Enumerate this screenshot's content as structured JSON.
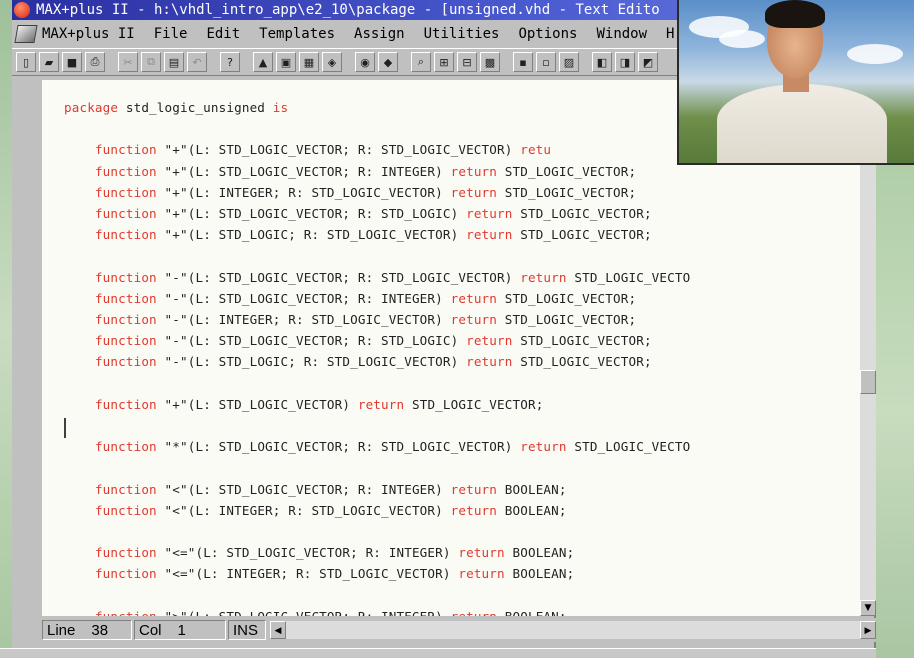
{
  "window": {
    "title": "MAX+plus II - h:\\vhdl_intro_app\\e2_10\\package - [unsigned.vhd - Text Edito"
  },
  "menu": {
    "items": [
      "MAX+plus II",
      "File",
      "Edit",
      "Templates",
      "Assign",
      "Utilities",
      "Options",
      "Window",
      "H"
    ]
  },
  "toolbar": {
    "buttons": [
      {
        "name": "new-file-icon",
        "glyph": "▯",
        "enabled": true
      },
      {
        "name": "open-folder-icon",
        "glyph": "▰",
        "enabled": true
      },
      {
        "name": "save-icon",
        "glyph": "■",
        "enabled": true
      },
      {
        "name": "print-icon",
        "glyph": "⎙",
        "enabled": true
      },
      {
        "name": "cut-icon",
        "glyph": "✂",
        "enabled": false
      },
      {
        "name": "copy-icon",
        "glyph": "⧉",
        "enabled": false
      },
      {
        "name": "paste-icon",
        "glyph": "▤",
        "enabled": true
      },
      {
        "name": "undo-icon",
        "glyph": "↶",
        "enabled": false
      },
      {
        "name": "help-icon",
        "glyph": "?",
        "enabled": true
      },
      {
        "name": "hierarchy-up-icon",
        "glyph": "▲",
        "enabled": true
      },
      {
        "name": "hierarchy-icon",
        "glyph": "▣",
        "enabled": true
      },
      {
        "name": "floorplan-icon",
        "glyph": "▦",
        "enabled": true
      },
      {
        "name": "symbol-icon",
        "glyph": "◈",
        "enabled": true
      },
      {
        "name": "graphic-editor-icon",
        "glyph": "◉",
        "enabled": true
      },
      {
        "name": "waveform-icon",
        "glyph": "◆",
        "enabled": true
      },
      {
        "name": "search-icon",
        "glyph": "⌕",
        "enabled": true
      },
      {
        "name": "find-icon",
        "glyph": "⊞",
        "enabled": true
      },
      {
        "name": "find-next-icon",
        "glyph": "⊟",
        "enabled": true
      },
      {
        "name": "compile-icon",
        "glyph": "▩",
        "enabled": true
      },
      {
        "name": "simulate-icon",
        "glyph": "▪",
        "enabled": true
      },
      {
        "name": "timing-icon",
        "glyph": "▫",
        "enabled": true
      },
      {
        "name": "program-icon",
        "glyph": "▨",
        "enabled": true
      },
      {
        "name": "project-icon",
        "glyph": "◧",
        "enabled": true
      },
      {
        "name": "project-save-icon",
        "glyph": "◨",
        "enabled": true
      },
      {
        "name": "project-compile-icon",
        "glyph": "◩",
        "enabled": true
      }
    ]
  },
  "editor": {
    "lines": [
      [
        {
          "t": "package",
          "k": true
        },
        {
          "t": " std_logic_unsigned "
        },
        {
          "t": "is",
          "k": true
        }
      ],
      [],
      [
        {
          "t": "    "
        },
        {
          "t": "function",
          "k": true
        },
        {
          "t": " \"+\"(L: STD_LOGIC_VECTOR; R: STD_LOGIC_VECTOR) "
        },
        {
          "t": "retu",
          "k": true
        }
      ],
      [
        {
          "t": "    "
        },
        {
          "t": "function",
          "k": true
        },
        {
          "t": " \"+\"(L: STD_LOGIC_VECTOR; R: INTEGER) "
        },
        {
          "t": "return",
          "k": true
        },
        {
          "t": " STD_LOGIC_VECTOR;"
        }
      ],
      [
        {
          "t": "    "
        },
        {
          "t": "function",
          "k": true
        },
        {
          "t": " \"+\"(L: INTEGER; R: STD_LOGIC_VECTOR) "
        },
        {
          "t": "return",
          "k": true
        },
        {
          "t": " STD_LOGIC_VECTOR;"
        }
      ],
      [
        {
          "t": "    "
        },
        {
          "t": "function",
          "k": true
        },
        {
          "t": " \"+\"(L: STD_LOGIC_VECTOR; R: STD_LOGIC) "
        },
        {
          "t": "return",
          "k": true
        },
        {
          "t": " STD_LOGIC_VECTOR;"
        }
      ],
      [
        {
          "t": "    "
        },
        {
          "t": "function",
          "k": true
        },
        {
          "t": " \"+\"(L: STD_LOGIC; R: STD_LOGIC_VECTOR) "
        },
        {
          "t": "return",
          "k": true
        },
        {
          "t": " STD_LOGIC_VECTOR;"
        }
      ],
      [],
      [
        {
          "t": "    "
        },
        {
          "t": "function",
          "k": true
        },
        {
          "t": " \"-\"(L: STD_LOGIC_VECTOR; R: STD_LOGIC_VECTOR) "
        },
        {
          "t": "return",
          "k": true
        },
        {
          "t": " STD_LOGIC_VECTO"
        }
      ],
      [
        {
          "t": "    "
        },
        {
          "t": "function",
          "k": true
        },
        {
          "t": " \"-\"(L: STD_LOGIC_VECTOR; R: INTEGER) "
        },
        {
          "t": "return",
          "k": true
        },
        {
          "t": " STD_LOGIC_VECTOR;"
        }
      ],
      [
        {
          "t": "    "
        },
        {
          "t": "function",
          "k": true
        },
        {
          "t": " \"-\"(L: INTEGER; R: STD_LOGIC_VECTOR) "
        },
        {
          "t": "return",
          "k": true
        },
        {
          "t": " STD_LOGIC_VECTOR;"
        }
      ],
      [
        {
          "t": "    "
        },
        {
          "t": "function",
          "k": true
        },
        {
          "t": " \"-\"(L: STD_LOGIC_VECTOR; R: STD_LOGIC) "
        },
        {
          "t": "return",
          "k": true
        },
        {
          "t": " STD_LOGIC_VECTOR;"
        }
      ],
      [
        {
          "t": "    "
        },
        {
          "t": "function",
          "k": true
        },
        {
          "t": " \"-\"(L: STD_LOGIC; R: STD_LOGIC_VECTOR) "
        },
        {
          "t": "return",
          "k": true
        },
        {
          "t": " STD_LOGIC_VECTOR;"
        }
      ],
      [],
      [
        {
          "t": "    "
        },
        {
          "t": "function",
          "k": true
        },
        {
          "t": " \"+\"(L: STD_LOGIC_VECTOR) "
        },
        {
          "t": "return",
          "k": true
        },
        {
          "t": " STD_LOGIC_VECTOR;"
        }
      ],
      [],
      [
        {
          "t": "    "
        },
        {
          "t": "function",
          "k": true
        },
        {
          "t": " \"*\"(L: STD_LOGIC_VECTOR; R: STD_LOGIC_VECTOR) "
        },
        {
          "t": "return",
          "k": true
        },
        {
          "t": " STD_LOGIC_VECTO"
        }
      ],
      [],
      [
        {
          "t": "    "
        },
        {
          "t": "function",
          "k": true
        },
        {
          "t": " \"<\"(L: STD_LOGIC_VECTOR; R: INTEGER) "
        },
        {
          "t": "return",
          "k": true
        },
        {
          "t": " BOOLEAN;"
        }
      ],
      [
        {
          "t": "    "
        },
        {
          "t": "function",
          "k": true
        },
        {
          "t": " \"<\"(L: INTEGER; R: STD_LOGIC_VECTOR) "
        },
        {
          "t": "return",
          "k": true
        },
        {
          "t": " BOOLEAN;"
        }
      ],
      [],
      [
        {
          "t": "    "
        },
        {
          "t": "function",
          "k": true
        },
        {
          "t": " \"<=\"(L: STD_LOGIC_VECTOR; R: INTEGER) "
        },
        {
          "t": "return",
          "k": true
        },
        {
          "t": " BOOLEAN;"
        }
      ],
      [
        {
          "t": "    "
        },
        {
          "t": "function",
          "k": true
        },
        {
          "t": " \"<=\"(L: INTEGER; R: STD_LOGIC_VECTOR) "
        },
        {
          "t": "return",
          "k": true
        },
        {
          "t": " BOOLEAN;"
        }
      ],
      [],
      [
        {
          "t": "    "
        },
        {
          "t": "function",
          "k": true
        },
        {
          "t": " \">\"(L: STD_LOGIC_VECTOR; R: INTEGER) "
        },
        {
          "t": "return",
          "k": true
        },
        {
          "t": " BOOLEAN;"
        }
      ]
    ]
  },
  "status": {
    "line_label": "Line",
    "line_value": "38",
    "col_label": "Col",
    "col_value": "1",
    "mode": "INS"
  },
  "colors": {
    "keyword": "#e0392f",
    "titlebar": "#2a2fa0"
  }
}
